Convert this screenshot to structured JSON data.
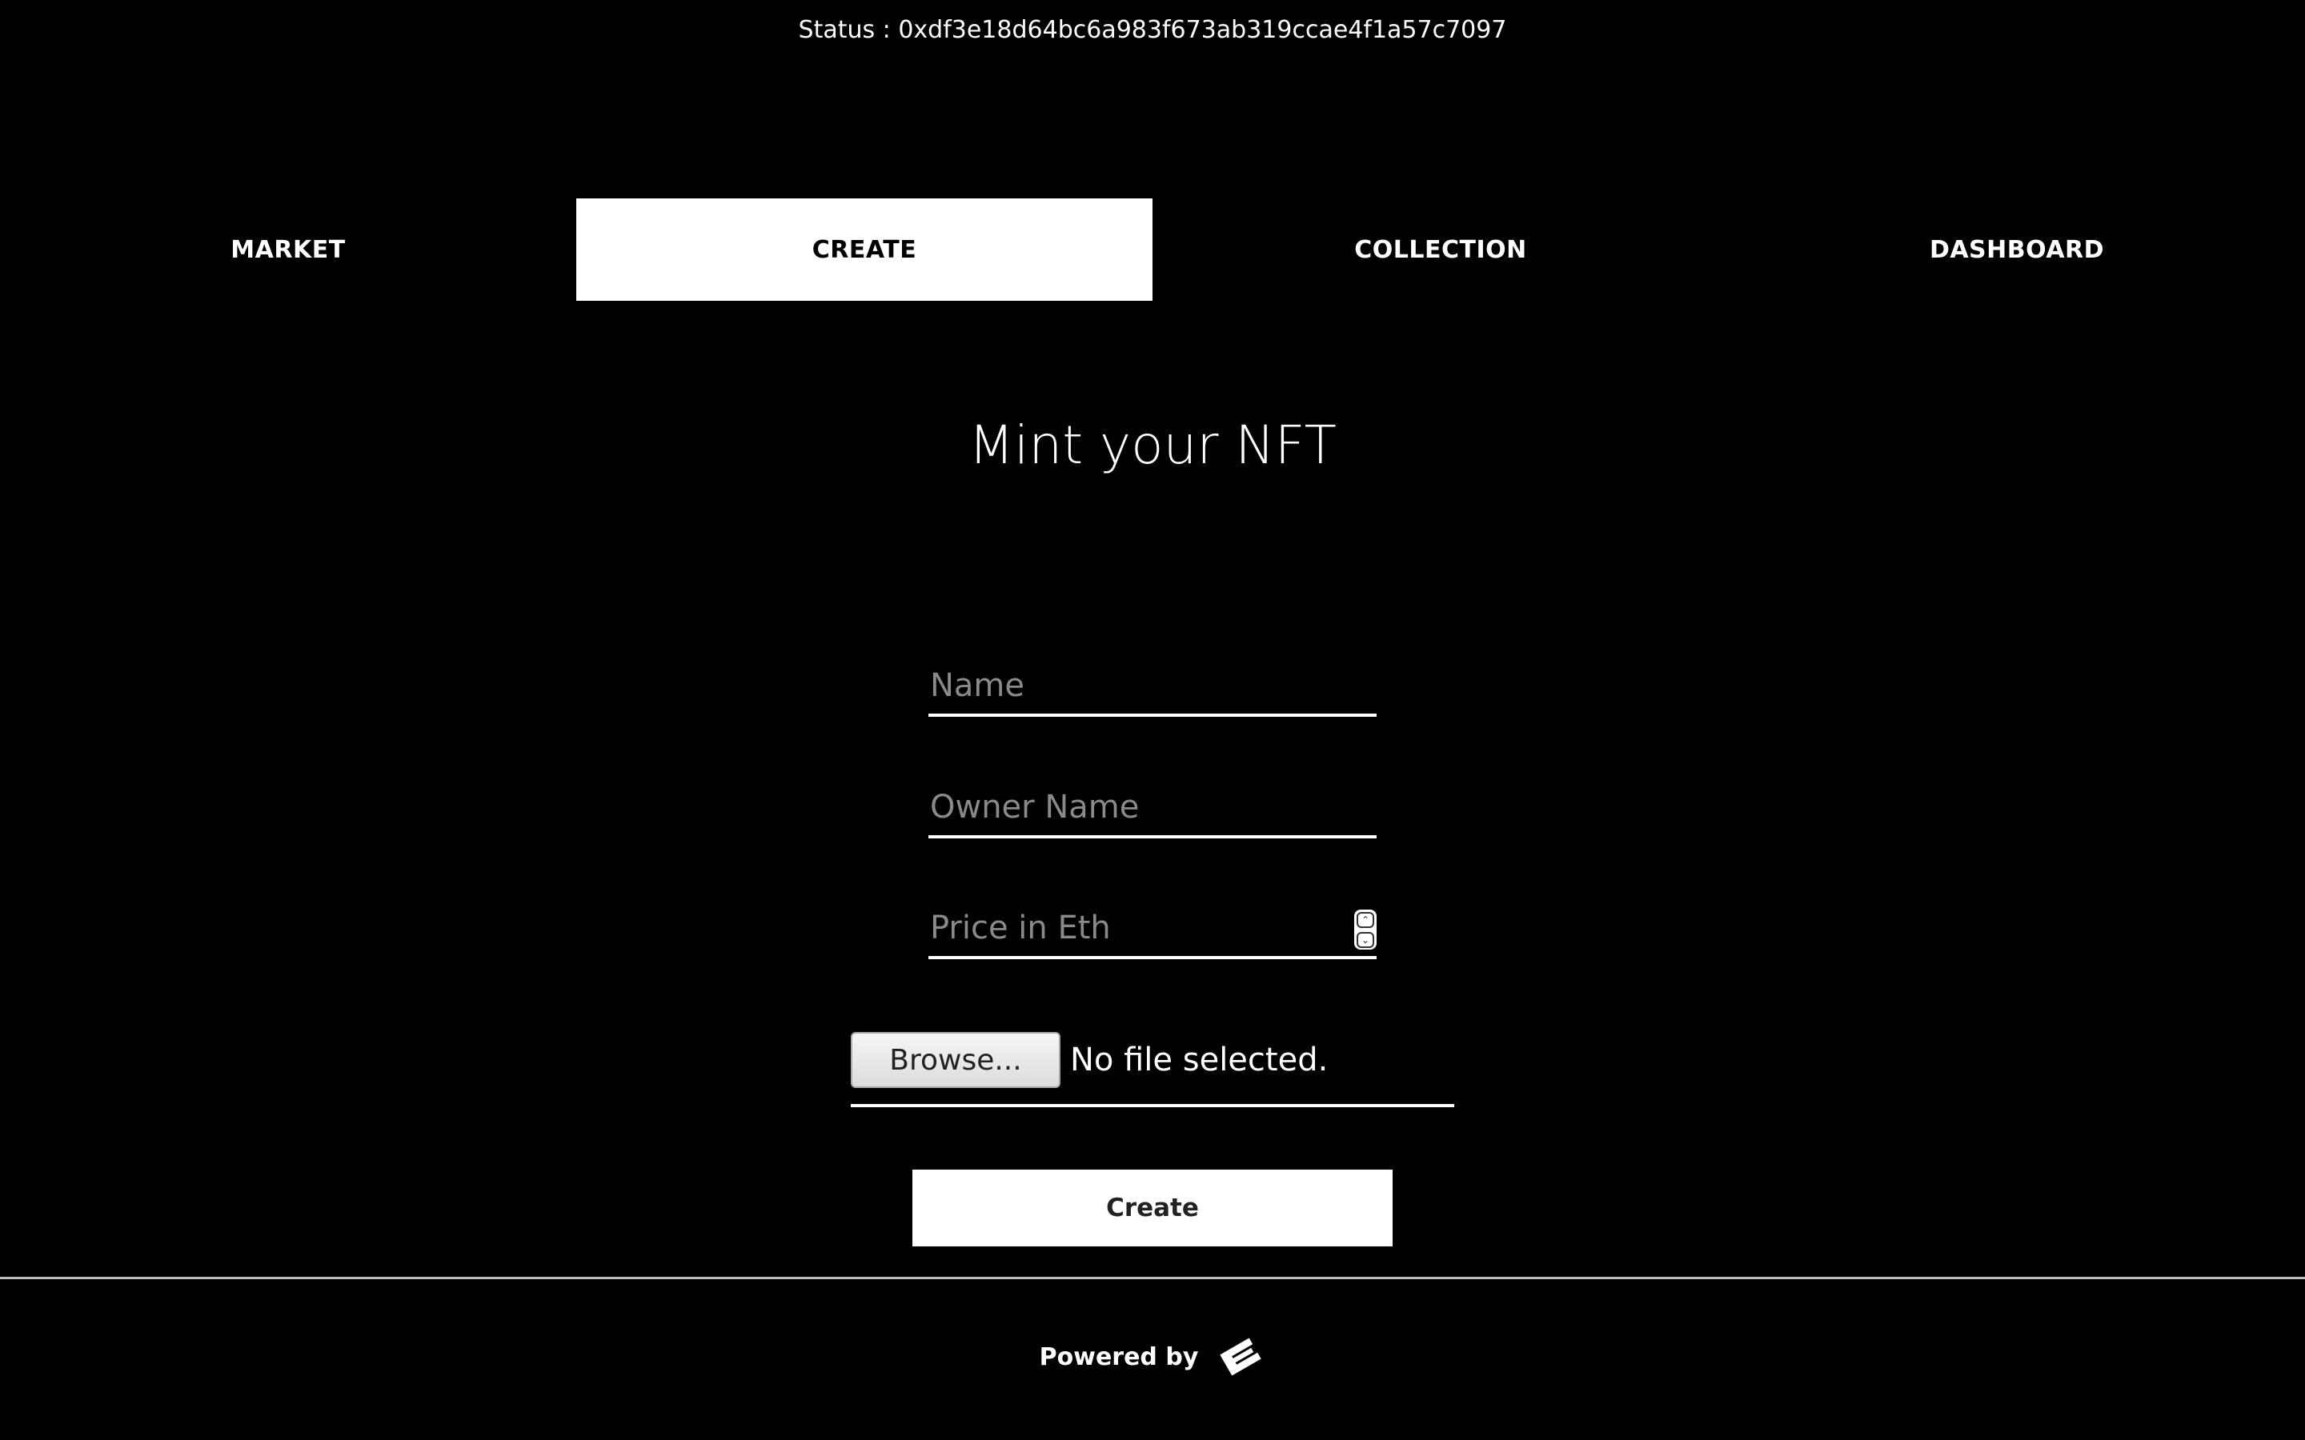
{
  "status": {
    "text": "Status : 0xdf3e18d64bc6a983f673ab319ccae4f1a57c7097"
  },
  "nav": {
    "items": [
      {
        "label": "MARKET",
        "active": false
      },
      {
        "label": "CREATE",
        "active": true
      },
      {
        "label": "COLLECTION",
        "active": false
      },
      {
        "label": "DASHBOARD",
        "active": false
      }
    ]
  },
  "form": {
    "title": "Mint your NFT",
    "name_placeholder": "Name",
    "owner_placeholder": "Owner Name",
    "price_placeholder": "Price in Eth",
    "browse_label": "Browse...",
    "file_status": "No file selected.",
    "create_label": "Create"
  },
  "footer": {
    "powered_label": "Powered by",
    "logo_icon": "brand-logo-icon"
  },
  "colors": {
    "background": "#000000",
    "foreground": "#ffffff",
    "placeholder": "#8a8a8a"
  }
}
